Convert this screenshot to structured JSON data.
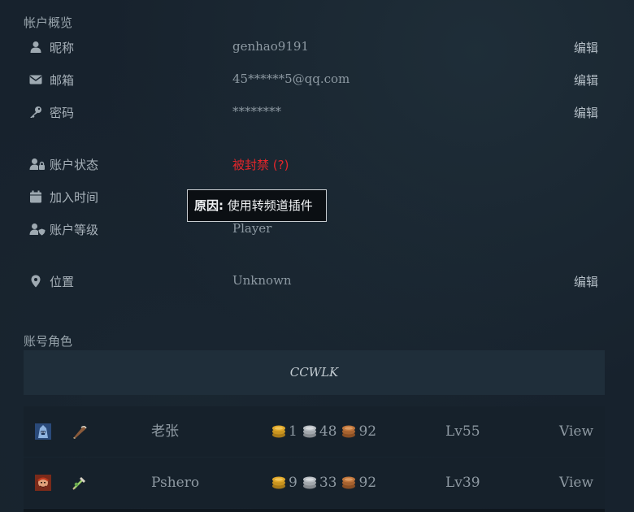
{
  "overview": {
    "title": "帐户概览",
    "rows": [
      {
        "label": "昵称",
        "value": "genhao9191",
        "edit": "编辑",
        "icon": "user-icon"
      },
      {
        "label": "邮箱",
        "value": "45******5@qq.com",
        "edit": "编辑",
        "icon": "envelope-icon"
      },
      {
        "label": "密码",
        "value": "********",
        "edit": "编辑",
        "icon": "key-icon"
      },
      {
        "label": "账户状态",
        "value": "被封禁 (?)",
        "icon": "user-lock-icon"
      },
      {
        "label": "加入时间",
        "value": "",
        "icon": "calendar-icon"
      },
      {
        "label": "账户等级",
        "value": "Player",
        "icon": "user-shield-icon"
      },
      {
        "label": "位置",
        "value": "Unknown",
        "edit": "编辑",
        "icon": "map-pin-icon"
      }
    ],
    "tooltip": {
      "prefix": "原因:",
      "text": " 使用转频道插件"
    }
  },
  "characters": {
    "title": "账号角色",
    "realm": "CCWLK",
    "rows": [
      {
        "name": "老张",
        "gold": "1",
        "silver": "48",
        "copper": "92",
        "level": "Lv55",
        "view": "View"
      },
      {
        "name": "Pshero",
        "gold": "9",
        "silver": "33",
        "copper": "92",
        "level": "Lv39",
        "view": "View"
      }
    ]
  },
  "colors": {
    "banned": "#e2262b",
    "gold": "#e0a82a",
    "silver": "#b9bec3",
    "copper": "#c0763c"
  }
}
